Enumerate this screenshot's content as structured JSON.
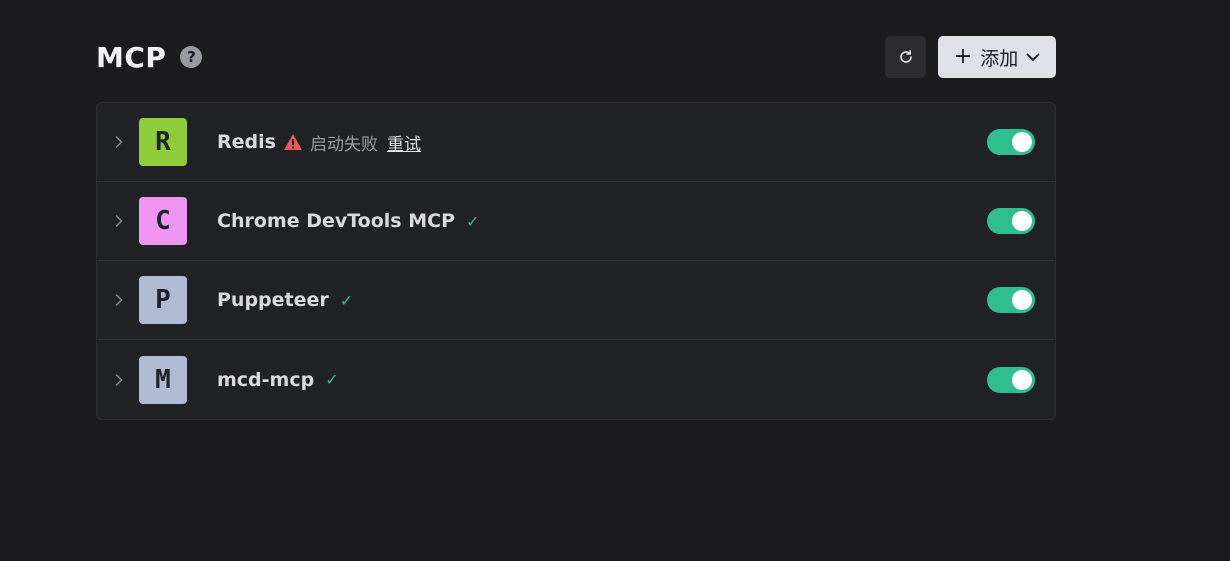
{
  "header": {
    "title": "MCP",
    "help_icon": "help-icon",
    "refresh_icon": "refresh-icon",
    "add_button": {
      "plus": "+",
      "label": "添加"
    }
  },
  "servers": [
    {
      "name": "Redis",
      "avatar_letter": "R",
      "avatar_color": "#8fcc3a",
      "status": "error",
      "status_text": "启动失败",
      "retry_label": "重试",
      "enabled": true
    },
    {
      "name": "Chrome DevTools MCP",
      "avatar_letter": "C",
      "avatar_color": "#ef96f4",
      "status": "ok",
      "status_mark": "✓",
      "enabled": true
    },
    {
      "name": "Puppeteer",
      "avatar_letter": "P",
      "avatar_color": "#aebbd2",
      "status": "ok",
      "status_mark": "✓",
      "enabled": true
    },
    {
      "name": "mcd-mcp",
      "avatar_letter": "M",
      "avatar_color": "#aebbd2",
      "status": "ok",
      "status_mark": "✓",
      "enabled": true
    }
  ],
  "colors": {
    "toggle_on": "#2fbf8f",
    "check": "#2fb88d",
    "warning": "#e45a5a"
  }
}
